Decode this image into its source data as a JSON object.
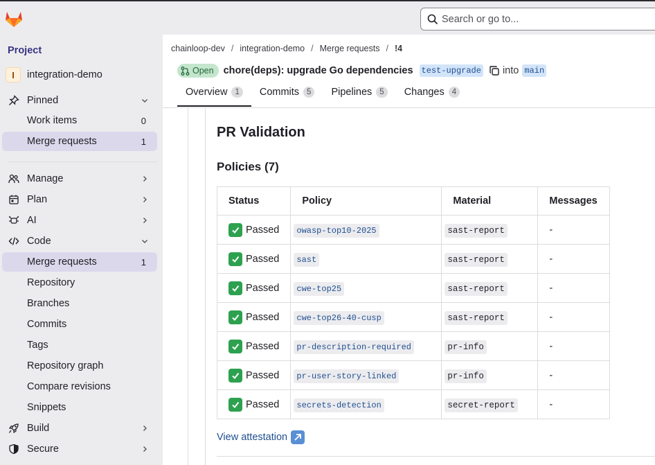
{
  "search": {
    "placeholder": "Search or go to..."
  },
  "sidebar": {
    "title": "Project",
    "project": {
      "initial": "I",
      "name": "integration-demo"
    },
    "items": [
      {
        "label": "Pinned",
        "icon": "pin-icon",
        "count": "",
        "chevron": "down",
        "active": false
      },
      {
        "label": "Work items",
        "icon": "",
        "count": "0",
        "chevron": "",
        "active": false
      },
      {
        "label": "Merge requests",
        "icon": "",
        "count": "1",
        "chevron": "",
        "active": true
      },
      {
        "label": "Manage",
        "icon": "users-icon",
        "count": "",
        "chevron": "right",
        "active": false
      },
      {
        "label": "Plan",
        "icon": "calendar-icon",
        "count": "",
        "chevron": "right",
        "active": false
      },
      {
        "label": "AI",
        "icon": "ai-icon",
        "count": "",
        "chevron": "right",
        "active": false
      },
      {
        "label": "Code",
        "icon": "code-icon",
        "count": "",
        "chevron": "down",
        "active": false
      },
      {
        "label": "Merge requests",
        "icon": "",
        "count": "1",
        "chevron": "",
        "active": true
      },
      {
        "label": "Repository",
        "icon": "",
        "count": "",
        "chevron": "",
        "active": false
      },
      {
        "label": "Branches",
        "icon": "",
        "count": "",
        "chevron": "",
        "active": false
      },
      {
        "label": "Commits",
        "icon": "",
        "count": "",
        "chevron": "",
        "active": false
      },
      {
        "label": "Tags",
        "icon": "",
        "count": "",
        "chevron": "",
        "active": false
      },
      {
        "label": "Repository graph",
        "icon": "",
        "count": "",
        "chevron": "",
        "active": false
      },
      {
        "label": "Compare revisions",
        "icon": "",
        "count": "",
        "chevron": "",
        "active": false
      },
      {
        "label": "Snippets",
        "icon": "",
        "count": "",
        "chevron": "",
        "active": false
      },
      {
        "label": "Build",
        "icon": "rocket-icon",
        "count": "",
        "chevron": "right",
        "active": false
      },
      {
        "label": "Secure",
        "icon": "shield-icon",
        "count": "",
        "chevron": "right",
        "active": false
      }
    ]
  },
  "breadcrumbs": [
    "chainloop-dev",
    "integration-demo",
    "Merge requests",
    "!4"
  ],
  "mr": {
    "state": "Open",
    "title": "chore(deps): upgrade Go dependencies",
    "source_branch": "test-upgrade",
    "into": "into",
    "target_branch": "main"
  },
  "tabs": [
    {
      "label": "Overview",
      "count": "1",
      "active": true
    },
    {
      "label": "Commits",
      "count": "5",
      "active": false
    },
    {
      "label": "Pipelines",
      "count": "5",
      "active": false
    },
    {
      "label": "Changes",
      "count": "4",
      "active": false
    }
  ],
  "content": {
    "heading": "PR Validation",
    "subheading": "Policies (7)",
    "columns": [
      "Status",
      "Policy",
      "Material",
      "Messages"
    ],
    "rows": [
      {
        "status": "Passed",
        "policy": "owasp-top10-2025",
        "material": "sast-report",
        "messages": "-"
      },
      {
        "status": "Passed",
        "policy": "sast",
        "material": "sast-report",
        "messages": "-"
      },
      {
        "status": "Passed",
        "policy": "cwe-top25",
        "material": "sast-report",
        "messages": "-"
      },
      {
        "status": "Passed",
        "policy": "cwe-top26-40-cusp",
        "material": "sast-report",
        "messages": "-"
      },
      {
        "status": "Passed",
        "policy": "pr-description-required",
        "material": "pr-info",
        "messages": "-"
      },
      {
        "status": "Passed",
        "policy": "pr-user-story-linked",
        "material": "pr-info",
        "messages": "-"
      },
      {
        "status": "Passed",
        "policy": "secrets-detection",
        "material": "secret-report",
        "messages": "-"
      }
    ],
    "link": "View attestation"
  },
  "colors": {
    "accent": "#3a3383",
    "open": "#24663b",
    "link": "#1f4e8f",
    "passed": "#2da14f"
  }
}
